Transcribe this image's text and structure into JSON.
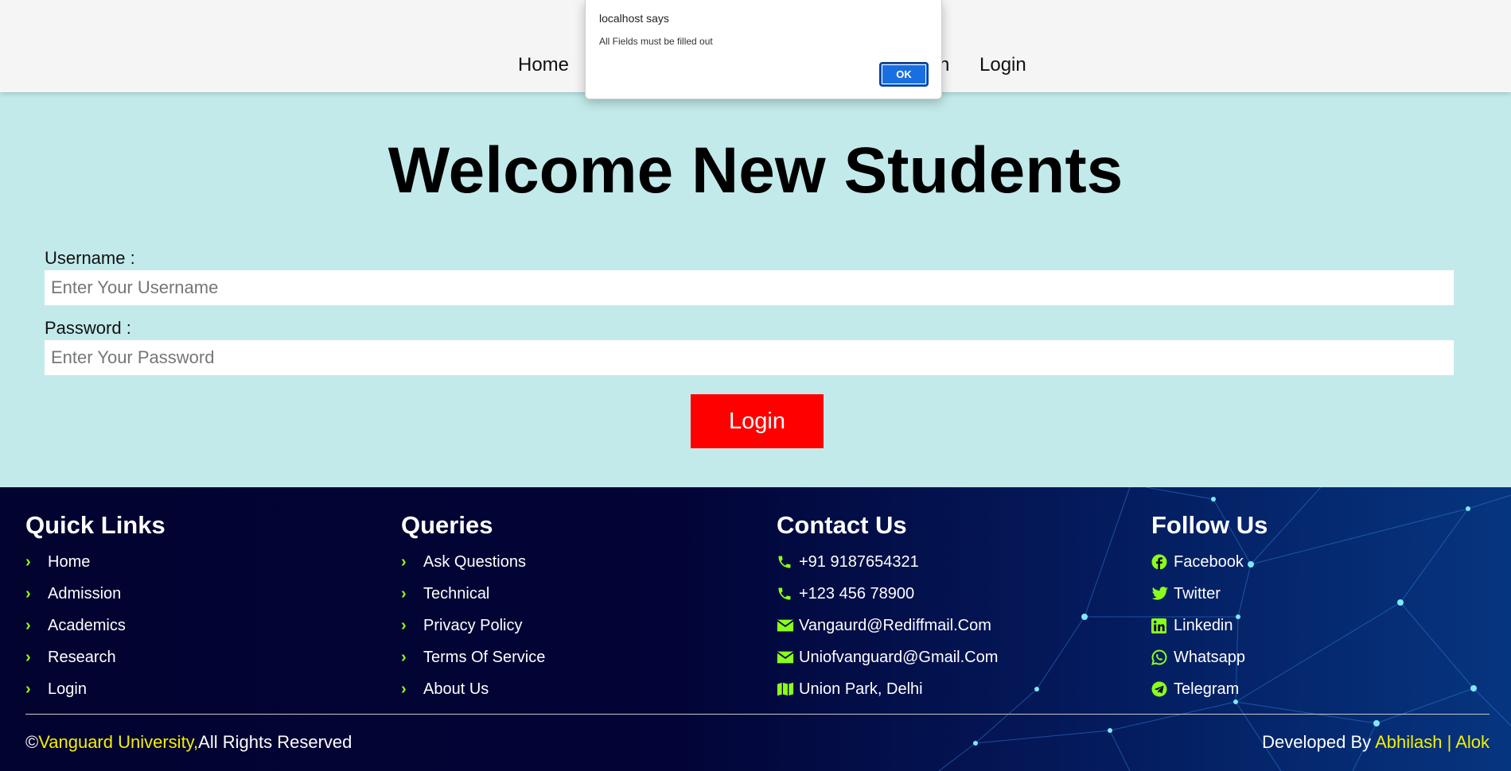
{
  "nav": {
    "items": [
      {
        "label": "Home"
      },
      {
        "label": "n"
      },
      {
        "label": "Login"
      }
    ]
  },
  "alert": {
    "title": "localhost says",
    "message": "All Fields must be filled out",
    "ok_label": "OK"
  },
  "main": {
    "title": "Welcome New Students",
    "username_label": "Username :",
    "username_placeholder": "Enter Your Username",
    "password_label": "Password :",
    "password_placeholder": "Enter Your Password",
    "login_button": "Login"
  },
  "footer": {
    "quick_links": {
      "title": "Quick Links",
      "items": [
        "Home",
        "Admission",
        "Academics",
        "Research",
        "Login"
      ]
    },
    "queries": {
      "title": "Queries",
      "items": [
        "Ask Questions",
        "Technical",
        "Privacy Policy",
        "Terms Of Service",
        "About Us"
      ]
    },
    "contact": {
      "title": "Contact Us",
      "items": [
        {
          "icon": "phone-icon",
          "text": "+91 9187654321"
        },
        {
          "icon": "phone-icon",
          "text": "+123 456 78900"
        },
        {
          "icon": "envelope-icon",
          "text": "Vangaurd@Rediffmail.Com"
        },
        {
          "icon": "envelope-icon",
          "text": "Uniofvanguard@Gmail.Com"
        },
        {
          "icon": "map-icon",
          "text": "Union Park, Delhi"
        }
      ]
    },
    "follow": {
      "title": "Follow Us",
      "items": [
        {
          "icon": "facebook-icon",
          "text": "Facebook"
        },
        {
          "icon": "twitter-icon",
          "text": "Twitter"
        },
        {
          "icon": "linkedin-icon",
          "text": "Linkedin"
        },
        {
          "icon": "whatsapp-icon",
          "text": "Whatsapp"
        },
        {
          "icon": "telegram-icon",
          "text": "Telegram"
        }
      ]
    },
    "copyright_symbol": "©",
    "university_name": "Vanguard University,",
    "rights": "All Rights Reserved",
    "developed_by": "Developed By",
    "dev1": "Abhilash",
    "separator": "|",
    "dev2": "Alok"
  },
  "colors": {
    "accent_green": "#8aff1c",
    "login_red": "#ff0000",
    "highlight_yellow": "#f3f000",
    "main_bg": "#c3eaea",
    "footer_bg": "#030330"
  }
}
